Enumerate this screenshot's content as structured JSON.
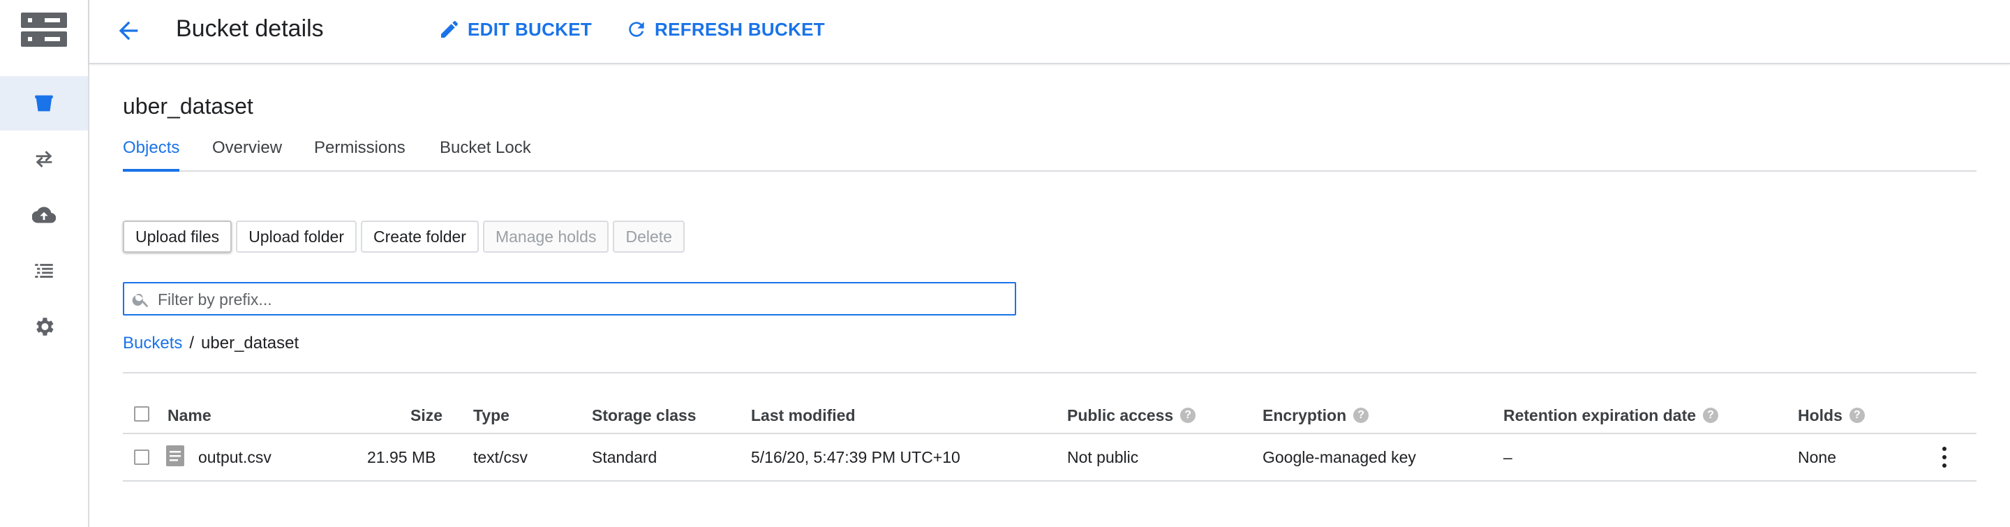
{
  "header": {
    "title": "Bucket details",
    "edit_label": "EDIT BUCKET",
    "refresh_label": "REFRESH BUCKET"
  },
  "rail": {
    "items": [
      {
        "icon": "bucket-icon",
        "active": true
      },
      {
        "icon": "transfer-icon",
        "active": false
      },
      {
        "icon": "cloud-upload-icon",
        "active": false
      },
      {
        "icon": "list-icon",
        "active": false
      },
      {
        "icon": "gear-icon",
        "active": false
      }
    ]
  },
  "bucket": {
    "name": "uber_dataset"
  },
  "tabs": [
    {
      "label": "Objects",
      "active": true
    },
    {
      "label": "Overview",
      "active": false
    },
    {
      "label": "Permissions",
      "active": false
    },
    {
      "label": "Bucket Lock",
      "active": false
    }
  ],
  "actions": {
    "upload_files": "Upload files",
    "upload_folder": "Upload folder",
    "create_folder": "Create folder",
    "manage_holds": "Manage holds",
    "delete": "Delete"
  },
  "filter": {
    "placeholder": "Filter by prefix..."
  },
  "breadcrumb": {
    "root": "Buckets",
    "separator": "/",
    "current": "uber_dataset"
  },
  "table": {
    "columns": {
      "name": "Name",
      "size": "Size",
      "type": "Type",
      "storage_class": "Storage class",
      "last_modified": "Last modified",
      "public_access": "Public access",
      "encryption": "Encryption",
      "retention": "Retention expiration date",
      "holds": "Holds"
    },
    "rows": [
      {
        "name": "output.csv",
        "size": "21.95 MB",
        "type": "text/csv",
        "storage_class": "Standard",
        "last_modified": "5/16/20, 5:47:39 PM UTC+10",
        "public_access": "Not public",
        "encryption": "Google-managed key",
        "retention": "–",
        "holds": "None"
      }
    ]
  },
  "colors": {
    "accent": "#1a73e8",
    "active_bg": "#e8eef7",
    "border": "#dadce0"
  }
}
